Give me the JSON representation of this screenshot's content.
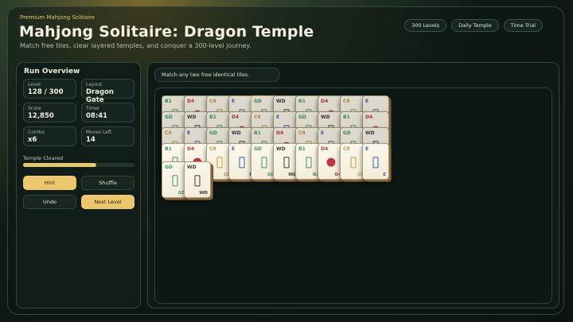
{
  "header": {
    "eyebrow": "Premium Mahjong Solitaire",
    "title": "Mahjong Solitaire: Dragon Temple",
    "subtitle": "Match free tiles, clear layered temples, and conquer a 300-level journey."
  },
  "modes": [
    "300 Levels",
    "Daily Temple",
    "Time Trial"
  ],
  "overview": {
    "title": "Run Overview",
    "stats": [
      {
        "label": "Level",
        "value": "128 / 300"
      },
      {
        "label": "Layout",
        "value": "Dragon Gate"
      },
      {
        "label": "Score",
        "value": "12,850"
      },
      {
        "label": "Timer",
        "value": "08:41"
      },
      {
        "label": "Combo",
        "value": "x6"
      },
      {
        "label": "Moves Left",
        "value": "14"
      }
    ],
    "progress_label": "Temple Cleared",
    "progress": 0.66,
    "actions": [
      "Hint",
      "Shuffle",
      "Undo",
      "Next Level"
    ]
  },
  "hint": "Match any two free identical tiles.",
  "tile_colors": {
    "B1": "#3a9a5f",
    "GD": "#3a9a5f",
    "D4": "#c0383e",
    "C8": "#c49a3a",
    "E": "#3a62b5",
    "WD": "#3a3a3a"
  },
  "board": {
    "layers": [
      {
        "rows": [
          [
            "B1",
            "D4",
            "C8",
            "E",
            "GD",
            "WD",
            "B1",
            "D4",
            "C8",
            "E"
          ],
          [
            "GD",
            "WD",
            "B1",
            "D4",
            "C8",
            "E",
            "GD",
            "WD",
            "B1",
            "D4"
          ],
          [
            "C8",
            "E",
            "GD",
            "WD",
            "B1",
            "D4",
            "C8",
            "E",
            "GD",
            "WD"
          ],
          [
            "B1",
            "D4",
            "C8",
            "E",
            "GD",
            "WD",
            "B1",
            "D4",
            "C8",
            "E"
          ]
        ]
      },
      {
        "rows": [
          [
            "GD",
            "WD"
          ]
        ]
      }
    ]
  }
}
